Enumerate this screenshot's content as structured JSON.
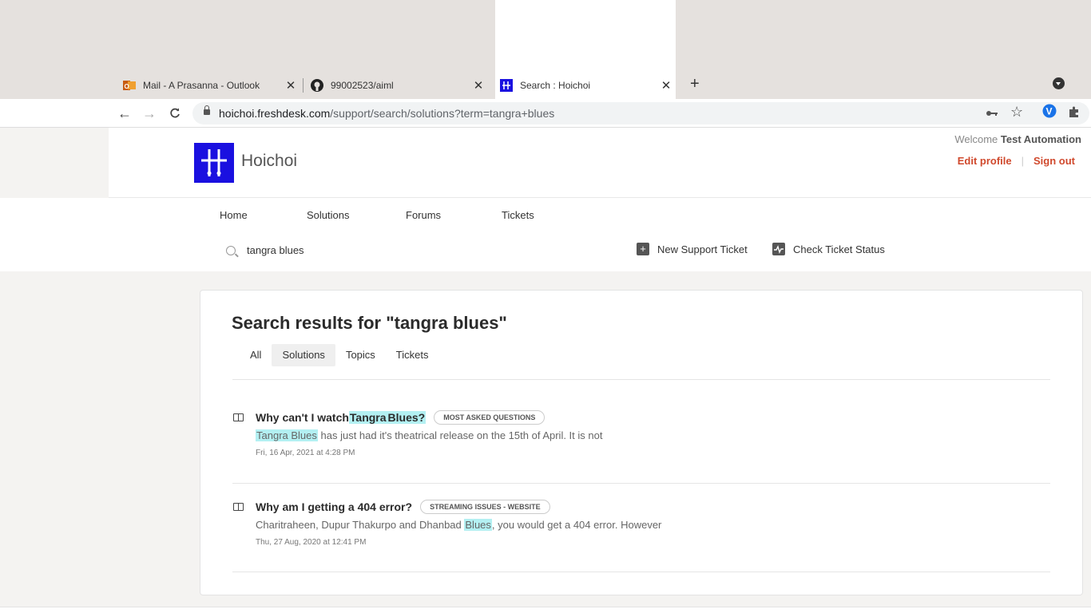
{
  "browser": {
    "tabs": [
      {
        "title": "Mail - A Prasanna - Outlook",
        "icon": "outlook-icon",
        "close": "✕"
      },
      {
        "title": "99002523/aiml",
        "icon": "github-icon",
        "close": "✕"
      },
      {
        "title": "Search : Hoichoi",
        "icon": "hoichoi-icon",
        "close": "✕"
      }
    ],
    "new_tab": "+",
    "url_host": "hoichoi.freshdesk.com",
    "url_path": "/support/search/solutions?term=tangra+blues"
  },
  "header": {
    "brand": "Hoichoi",
    "welcome_prefix": "Welcome",
    "user_name": "Test Automation",
    "edit_profile": "Edit profile",
    "separator": "|",
    "sign_out": "Sign out"
  },
  "nav": {
    "home": "Home",
    "solutions": "Solutions",
    "forums": "Forums",
    "tickets": "Tickets",
    "search_value": "tangra blues",
    "new_ticket": "New Support Ticket",
    "check_status": "Check Ticket Status"
  },
  "results": {
    "title": "Search results for \"tangra blues\"",
    "filters": [
      "All",
      "Solutions",
      "Topics",
      "Tickets"
    ],
    "active_filter": "Solutions",
    "items": [
      {
        "title_pre": "Why can't I watch ",
        "title_hl1": "Tangra",
        "title_mid": " ",
        "title_hl2": "Blues?",
        "badge": "MOST ASKED QUESTIONS",
        "snip_hl": "Tangra Blues",
        "snip_rest": " has just had it's theatrical release on the 15th of April. It is not",
        "date": "Fri, 16 Apr, 2021 at 4:28 PM"
      },
      {
        "title": "Why am I getting a 404 error?",
        "badge": "STREAMING ISSUES - WEBSITE",
        "snip_pre": "Charitraheen, Dupur Thakurpo and Dhanbad ",
        "snip_hl": "Blues",
        "snip_rest": ", you would get a 404 error. However",
        "date": "Thu, 27 Aug, 2020 at 12:41 PM"
      }
    ]
  },
  "colors": {
    "accent": "#d0492d",
    "logo_bg": "#1a10e0",
    "highlight": "#b3f0f2"
  }
}
